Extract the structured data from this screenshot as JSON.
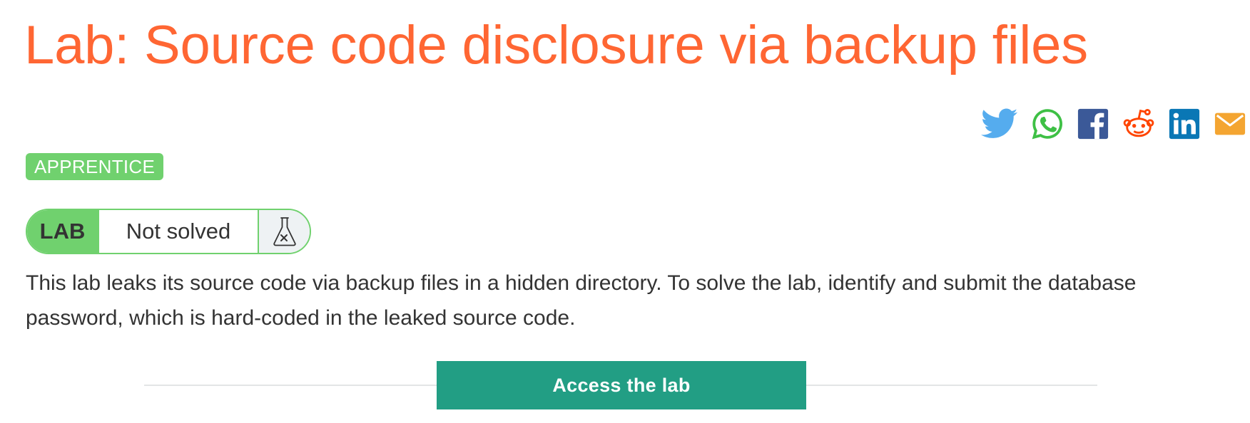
{
  "page": {
    "title": "Lab: Source code disclosure via backup files"
  },
  "share": {
    "icons": [
      "twitter-icon",
      "whatsapp-icon",
      "facebook-icon",
      "reddit-icon",
      "linkedin-icon",
      "email-icon"
    ],
    "colors": {
      "twitter": "#55acee",
      "whatsapp": "#3ec045",
      "facebook": "#3b5998",
      "reddit": "#ff4500",
      "linkedin": "#0a77b5",
      "email": "#f4a531"
    }
  },
  "badge": {
    "level": "APPRENTICE"
  },
  "lab_status": {
    "tag": "LAB",
    "status": "Not solved",
    "icon": "flask-icon"
  },
  "description": {
    "text": "This lab leaks its source code via backup files in a hidden directory. To solve the lab, identify and submit the database password, which is hard-coded in the leaked source code."
  },
  "actions": {
    "access_label": "Access the lab"
  },
  "theme": {
    "title_color": "#ff6633",
    "badge_green": "#70d16e",
    "button_teal": "#229e84",
    "text_color": "#333333"
  }
}
